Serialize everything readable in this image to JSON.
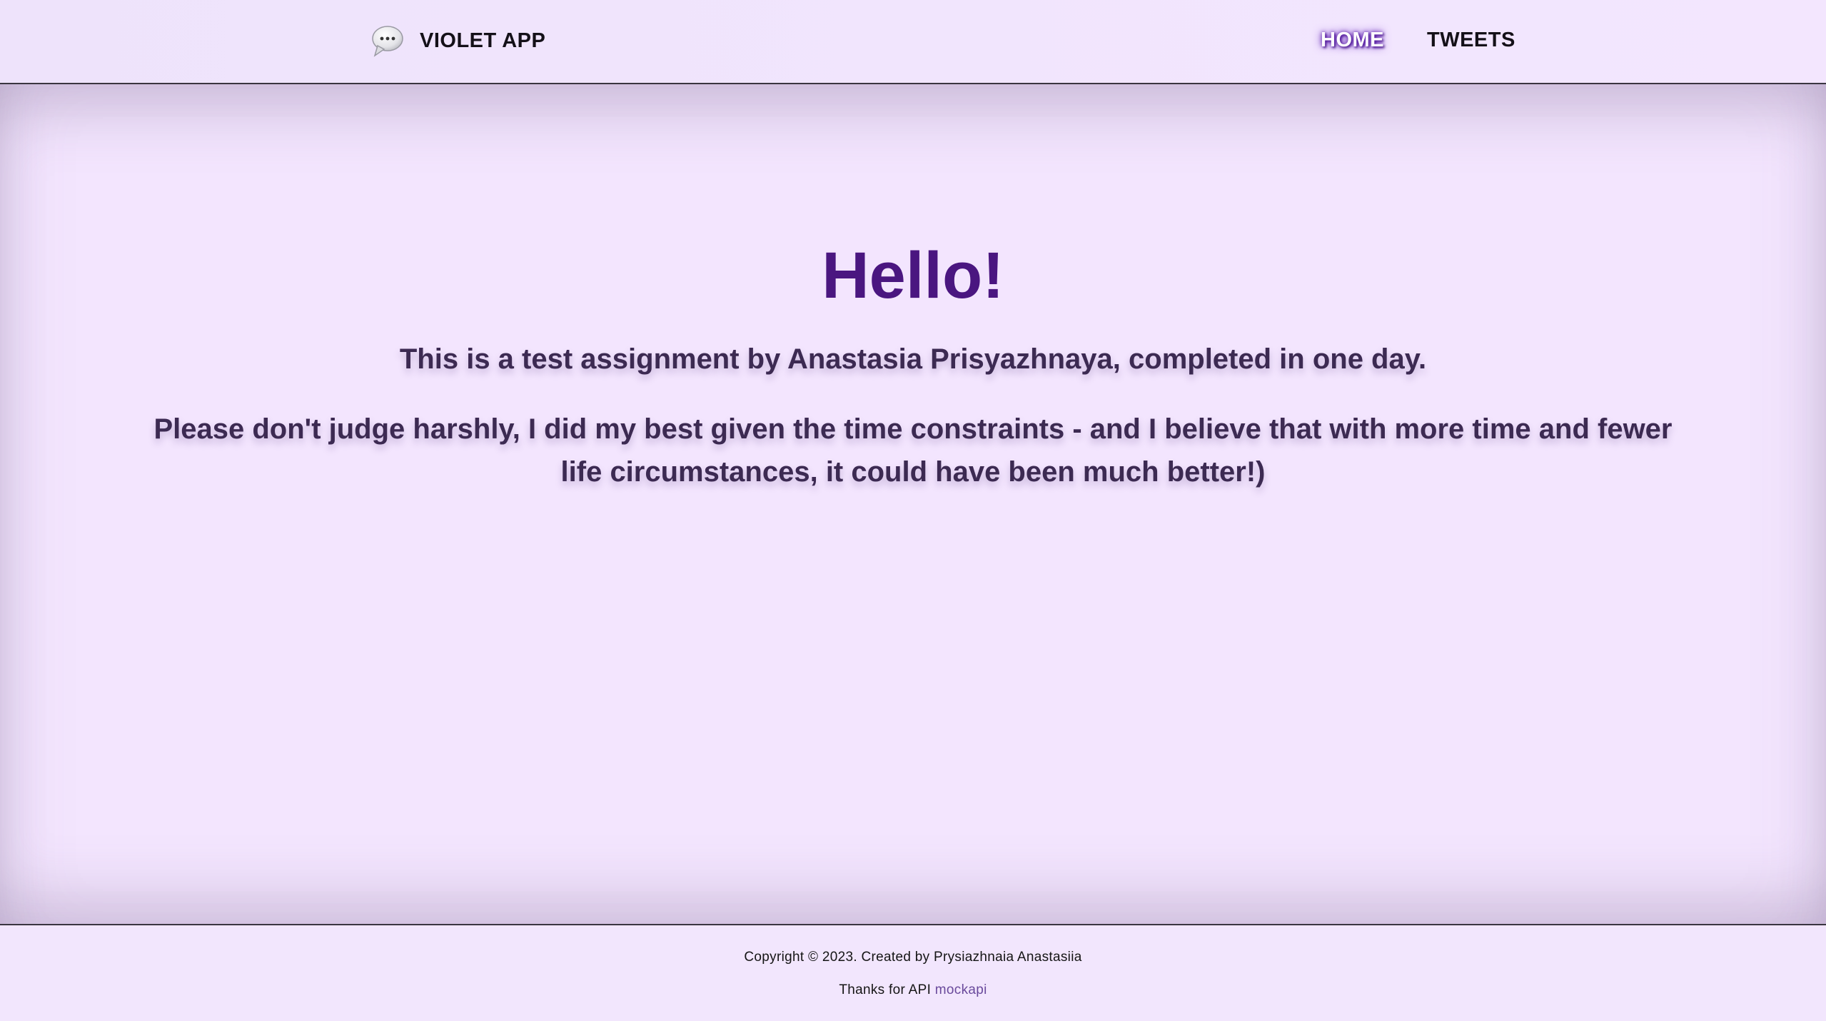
{
  "header": {
    "logo_text": "VIOLET APP",
    "logo_icon": "speech-bubble-icon",
    "nav": [
      {
        "label": "HOME",
        "active": true
      },
      {
        "label": "TWEETS",
        "active": false
      }
    ]
  },
  "main": {
    "title": "Hello!",
    "line1": "This is a test assignment by Anastasia Prisyazhnaya, completed in one day.",
    "line2": "Please don't judge harshly, I did my best given the time constraints - and I believe that with more time and fewer life circumstances, it could have been much better!)"
  },
  "footer": {
    "copyright": "Copyright © 2023. Created by Prysiazhnaia Anastasiia",
    "thanks_prefix": "Thanks for API",
    "api_link_label": "mockapi"
  },
  "colors": {
    "background": "#f2e6fd",
    "title": "#4a1680",
    "body_text": "#3c2a52",
    "link": "#6a4a9c"
  }
}
